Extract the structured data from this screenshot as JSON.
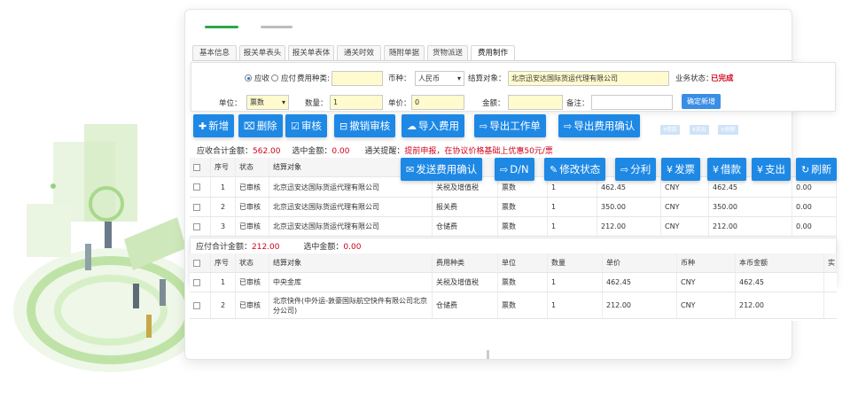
{
  "tabs": [
    "基本信息",
    "报关单表头",
    "报关单表体",
    "通关时效",
    "随附单据",
    "货物派送",
    "费用制作"
  ],
  "active_tab": 6,
  "form": {
    "radio_receivable": "应收",
    "radio_payable": "应付",
    "fee_type_label": "费用种类:",
    "fee_type_value": "",
    "currency_label": "币种：",
    "currency_value": "人民币",
    "settlement_label": "结算对象：",
    "settlement_value": "北京迅安达国际货运代理有限公司",
    "status_label": "业务状态：",
    "status_value": "已完成",
    "unit_label": "单位：",
    "unit_value": "票数",
    "qty_label": "数量：",
    "qty_value": "1",
    "price_label": "单价：",
    "price_value": "0",
    "amount_label": "金额：",
    "amount_value": "",
    "remark_label": "备注：",
    "remark_value": "",
    "confirm_label": "确定新增"
  },
  "toolbar1": [
    {
      "icon": "plus-icon",
      "glyph": "✚",
      "label": "新增"
    },
    {
      "icon": "trash-icon",
      "glyph": "🗑",
      "label": "删除"
    },
    {
      "icon": "check-icon",
      "glyph": "☑",
      "label": "审核"
    },
    {
      "icon": "undo-icon",
      "glyph": "⊟",
      "label": "撤销审核"
    },
    {
      "icon": "cloud-upload-icon",
      "glyph": "☁",
      "label": "导入费用"
    },
    {
      "icon": "export-icon",
      "glyph": "⇨",
      "label": "导出工作单"
    },
    {
      "icon": "export-icon",
      "glyph": "⇨",
      "label": "导出费用确认"
    }
  ],
  "toolbar2": [
    {
      "icon": "envelope-icon",
      "glyph": "✉",
      "label": "发送费用确认"
    },
    {
      "icon": "export-icon",
      "glyph": "⇨",
      "label": "D/N"
    },
    {
      "icon": "pencil-icon",
      "glyph": "✎",
      "label": "修改状态"
    },
    {
      "icon": "share-icon",
      "glyph": "⇨",
      "label": "分利"
    },
    {
      "icon": "yen-icon",
      "glyph": "¥",
      "label": "发票"
    },
    {
      "icon": "yen-icon",
      "glyph": "¥",
      "label": "借款"
    },
    {
      "icon": "yen-icon",
      "glyph": "¥",
      "label": "支出"
    },
    {
      "icon": "refresh-icon",
      "glyph": "↻",
      "label": "刷新"
    }
  ],
  "ghost_buttons": [
    "¥借款",
    "¥支出",
    "↻刷新"
  ],
  "receivable_summary": {
    "total_label": "应收合计金额：",
    "total_value": "562.00",
    "selected_label": "选中金额：",
    "selected_value": "0.00",
    "notice_label": "通关提醒：",
    "notice_text": "提前申报，在协议价格基础上优惠50元/票"
  },
  "receivable_table": {
    "headers": [
      "序号",
      "状态",
      "结算对象",
      "",
      "",
      "",
      "",
      "",
      "",
      ""
    ],
    "rows": [
      [
        "1",
        "已审核",
        "北京迅安达国际货运代理有限公司",
        "关税及增值税",
        "票数",
        "1",
        "462.45",
        "CNY",
        "462.45",
        "0.00"
      ],
      [
        "2",
        "已审核",
        "北京迅安达国际货运代理有限公司",
        "报关费",
        "票数",
        "1",
        "350.00",
        "CNY",
        "350.00",
        "0.00"
      ],
      [
        "3",
        "已审核",
        "北京迅安达国际货运代理有限公司",
        "仓储费",
        "票数",
        "1",
        "212.00",
        "CNY",
        "212.00",
        "0.00"
      ]
    ]
  },
  "payable_summary": {
    "total_label": "应付合计金额：",
    "total_value": "212.00",
    "selected_label": "选中金额：",
    "selected_value": "0.00"
  },
  "payable_table": {
    "headers": [
      "序号",
      "状态",
      "结算对象",
      "费用种类",
      "单位",
      "数量",
      "单价",
      "币种",
      "本币金额",
      "实"
    ],
    "rows": [
      [
        "1",
        "已审核",
        "中央金库",
        "关税及增值税",
        "票数",
        "1",
        "462.45",
        "CNY",
        "462.45"
      ],
      [
        "2",
        "已审核",
        "北京快件(中外运-敦豪国际航空快件有限公司北京分公司)",
        "仓储费",
        "票数",
        "1",
        "212.00",
        "CNY",
        "212.00"
      ]
    ]
  },
  "colors": {
    "accent": "#1e88e5",
    "green": "#2aa94a",
    "alert": "#d0021b",
    "highlight": "#fffbcf"
  }
}
